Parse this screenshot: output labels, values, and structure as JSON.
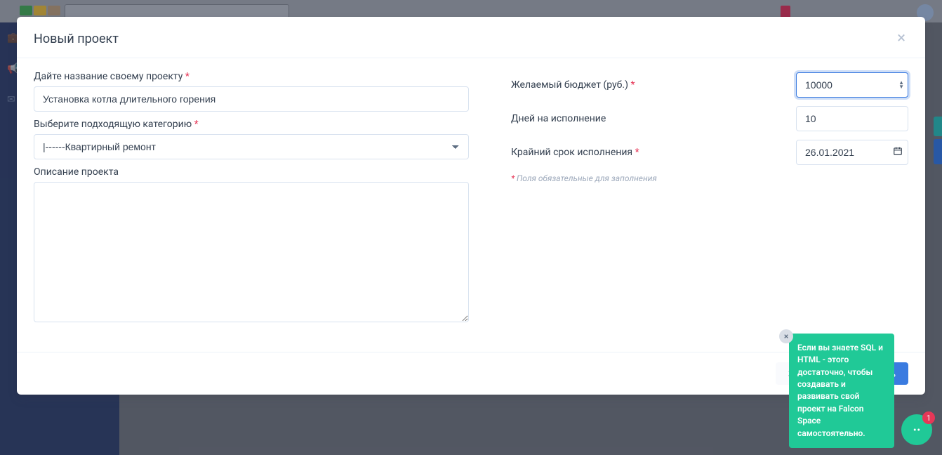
{
  "modal": {
    "title": "Новый проект",
    "left": {
      "name_label": "Дайте название своему проекту",
      "name_value": "Установка котла длительного горения",
      "category_label": "Выберите подходящую категорию",
      "category_value": "|------Квартирный ремонт",
      "description_label": "Описание проекта",
      "description_value": ""
    },
    "right": {
      "budget_label": "Желаемый бюджет (руб.)",
      "budget_value": "10000",
      "days_label": "Дней на исполнение",
      "days_value": "10",
      "deadline_label": "Крайний срок исполнения",
      "deadline_value": "26.01.2021",
      "hint": " Поля обязательные для заполнения"
    },
    "footer": {
      "close_label": "Закрыть",
      "create_label": "Создать"
    }
  },
  "tooltip": {
    "text": "Если вы знаете SQL и HTML - этого достаточно, чтобы создавать и развивать свой проект на Falcon Space самостоятельно."
  },
  "chat": {
    "badge": "1"
  },
  "required_mark": "*"
}
